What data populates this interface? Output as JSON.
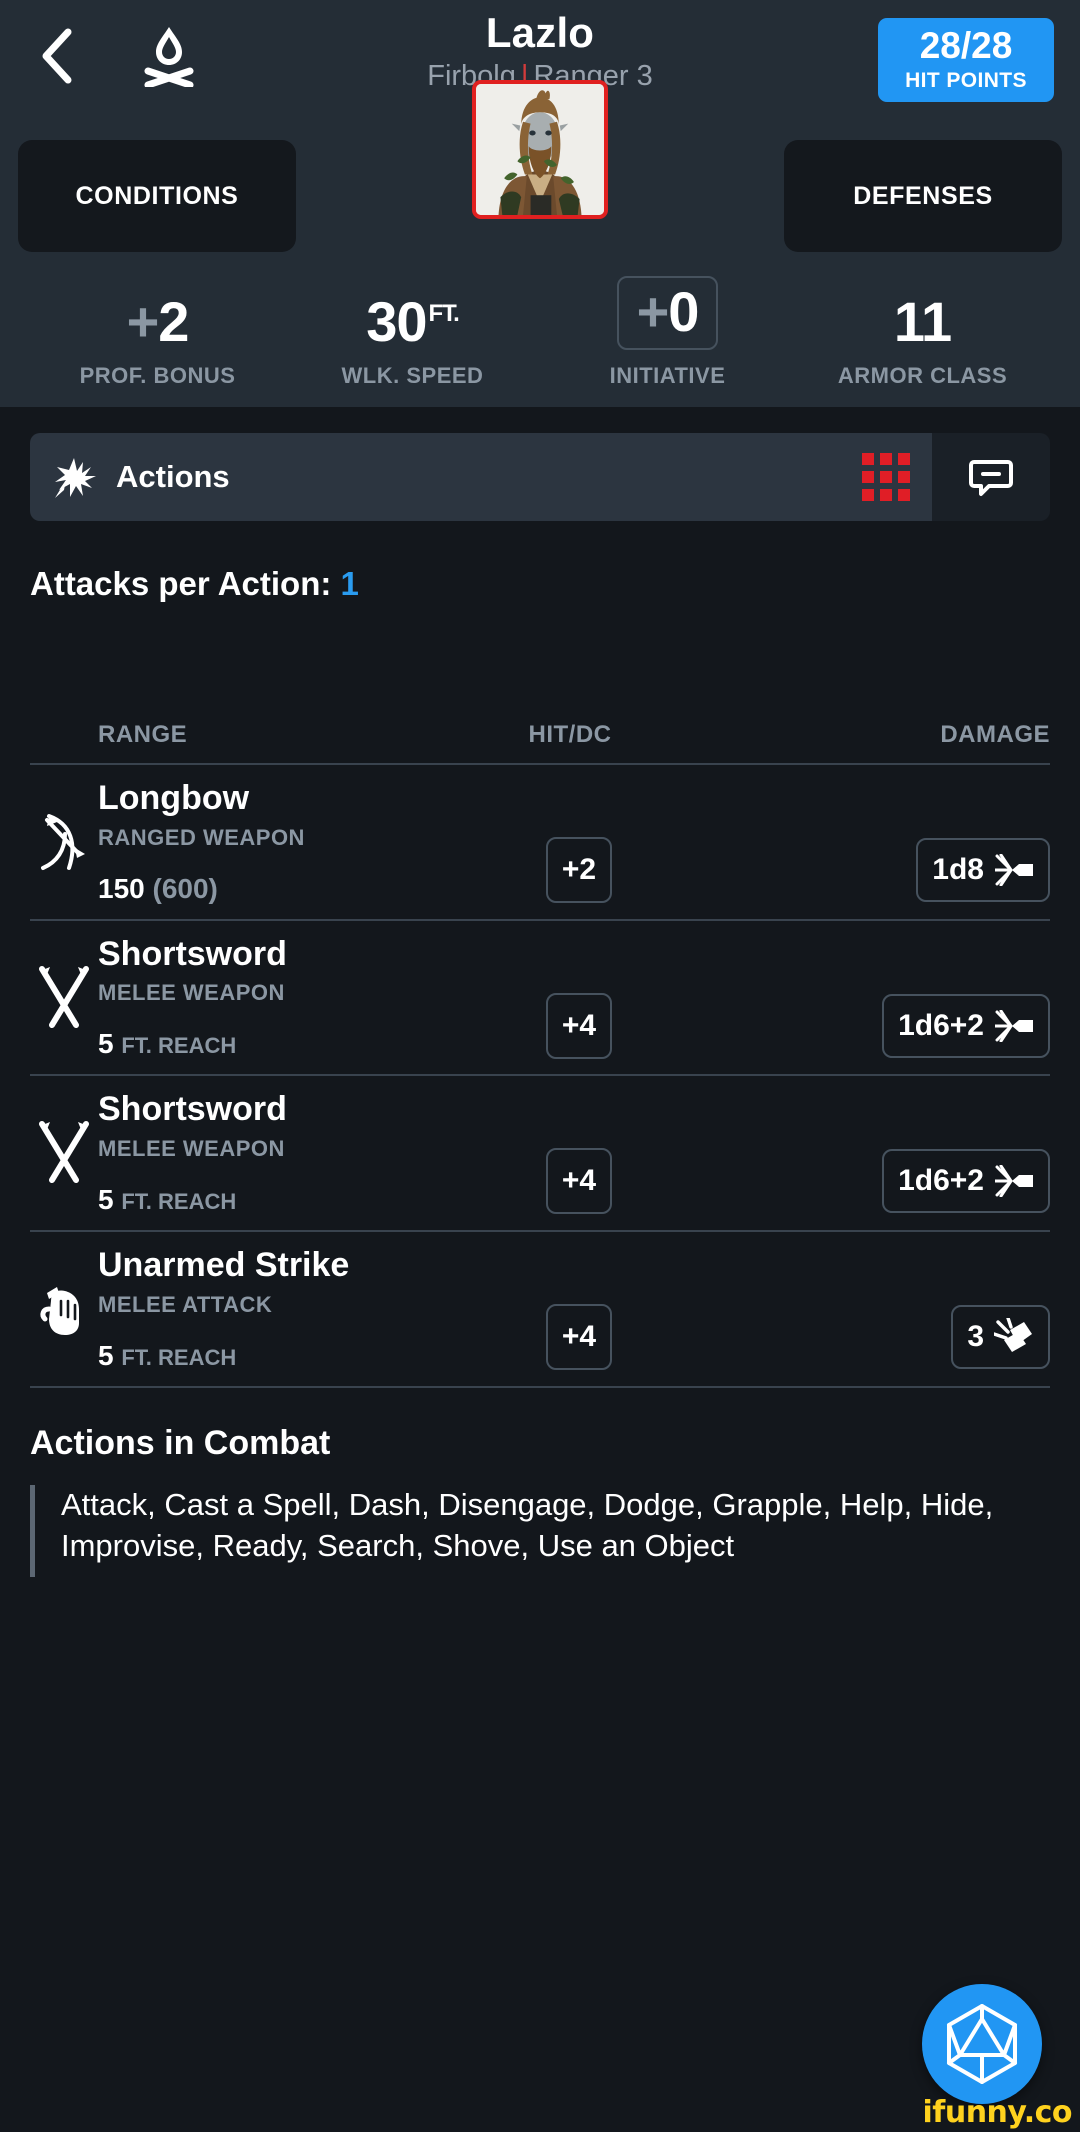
{
  "header": {
    "back_icon": "chevron-left-icon",
    "campfire_icon": "campfire-icon",
    "name": "Lazlo",
    "race": "Firbolg",
    "separator": "|",
    "class_level": "Ranger 3",
    "hp_value": "28/28",
    "hp_label": "HIT POINTS",
    "hp_color": "#2196f3"
  },
  "mid": {
    "conditions_label": "CONDITIONS",
    "defenses_label": "DEFENSES",
    "avatar_name": "character-portrait",
    "avatar_border_color": "#e02020"
  },
  "stats": [
    {
      "sign": "+",
      "value": "2",
      "unit": "",
      "label": "PROF. BONUS",
      "boxed": false
    },
    {
      "sign": "",
      "value": "30",
      "unit": "FT.",
      "label": "WLK. SPEED",
      "boxed": false
    },
    {
      "sign": "+",
      "value": "0",
      "unit": "",
      "label": "INITIATIVE",
      "boxed": true
    },
    {
      "sign": "",
      "value": "11",
      "unit": "",
      "label": "ARMOR CLASS",
      "boxed": false
    }
  ],
  "actions_bar": {
    "icon": "action-burst-icon",
    "label": "Actions",
    "grid_icon": "grid-dots-icon",
    "grid_color": "#e01e26",
    "chat_icon": "speech-bubble-minus-icon"
  },
  "attacks_per_action": {
    "label": "Attacks per Action:",
    "value": "1",
    "value_color": "#2a9cf0"
  },
  "table": {
    "headers": {
      "range": "RANGE",
      "hit": "HIT/DC",
      "damage": "DAMAGE"
    },
    "rows": [
      {
        "icon": "bow-and-arrow-icon",
        "name": "Longbow",
        "type": "RANGED WEAPON",
        "range_main": "150",
        "range_paren": "(600)",
        "range_suffix": "",
        "hit": "+2",
        "damage": "1d8",
        "damage_type_icon": "piercing-icon"
      },
      {
        "icon": "crossed-swords-icon",
        "name": "Shortsword",
        "type": "MELEE WEAPON",
        "range_main": "5",
        "range_paren": "",
        "range_suffix": "FT. REACH",
        "hit": "+4",
        "damage": "1d6+2",
        "damage_type_icon": "piercing-icon"
      },
      {
        "icon": "crossed-swords-icon",
        "name": "Shortsword",
        "type": "MELEE WEAPON",
        "range_main": "5",
        "range_paren": "",
        "range_suffix": "FT. REACH",
        "hit": "+4",
        "damage": "1d6+2",
        "damage_type_icon": "piercing-icon"
      },
      {
        "icon": "fist-icon",
        "name": "Unarmed Strike",
        "type": "MELEE ATTACK",
        "range_main": "5",
        "range_paren": "",
        "range_suffix": "FT. REACH",
        "hit": "+4",
        "damage": "3",
        "damage_type_icon": "bludgeoning-icon"
      }
    ]
  },
  "actions_in_combat": {
    "title": "Actions in Combat",
    "text": "Attack, Cast a Spell, Dash, Disengage, Dodge, Grapple, Help, Hide, Improvise, Ready, Search, Shove, Use an Object"
  },
  "fab": {
    "icon": "d20-dice-icon",
    "color": "#2196f3"
  },
  "watermark": {
    "text": "ifunny.co",
    "color": "#ffd21e"
  }
}
